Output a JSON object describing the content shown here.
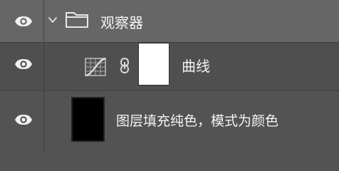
{
  "layers_panel": {
    "layers": [
      {
        "type": "group",
        "name": "观察器",
        "visible": true,
        "expanded": true,
        "icons": [
          "eye-icon",
          "chevron-down-icon",
          "folder-icon"
        ]
      },
      {
        "type": "adjustment",
        "name": "曲线",
        "visible": true,
        "icons": [
          "eye-icon",
          "curves-adjustment-icon",
          "link-icon",
          "mask-thumbnail"
        ]
      },
      {
        "type": "fill",
        "name": "图层填充纯色，模式为颜色",
        "visible": true,
        "icons": [
          "eye-icon",
          "fill-thumbnail"
        ]
      }
    ]
  },
  "colors": {
    "panel_bg": "#535353",
    "group_row_bg": "#666666",
    "selected_row_bg": "#4f4f4f",
    "text": "#f4f4f4",
    "mask_color": "#ffffff",
    "fill_color": "#000000"
  }
}
